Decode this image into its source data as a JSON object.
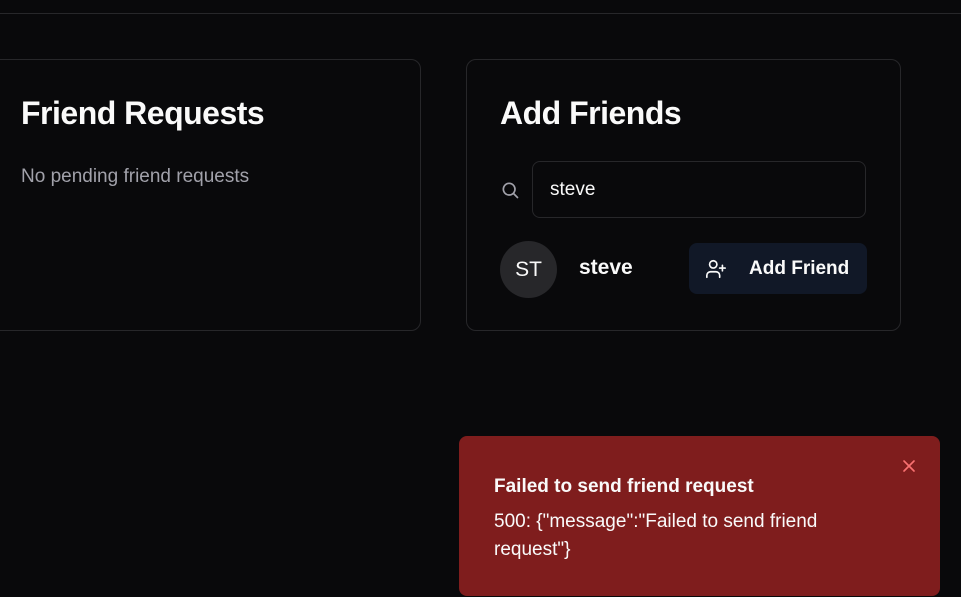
{
  "friend_requests": {
    "title": "Friend Requests",
    "empty_text": "No pending friend requests"
  },
  "add_friends": {
    "title": "Add Friends",
    "search_value": "steve",
    "search_icon": "search-icon",
    "result": {
      "initials": "ST",
      "username": "steve",
      "button_label": "Add Friend",
      "button_icon": "user-plus-icon"
    }
  },
  "toast": {
    "title": "Failed to send friend request",
    "description": "500: {\"message\":\"Failed to send friend request\"}",
    "close_icon": "close-icon",
    "background": "#7f1d1d"
  },
  "colors": {
    "background": "#09090b",
    "border": "#27272a",
    "muted_text": "#a1a1aa",
    "button_bg": "#111827"
  }
}
